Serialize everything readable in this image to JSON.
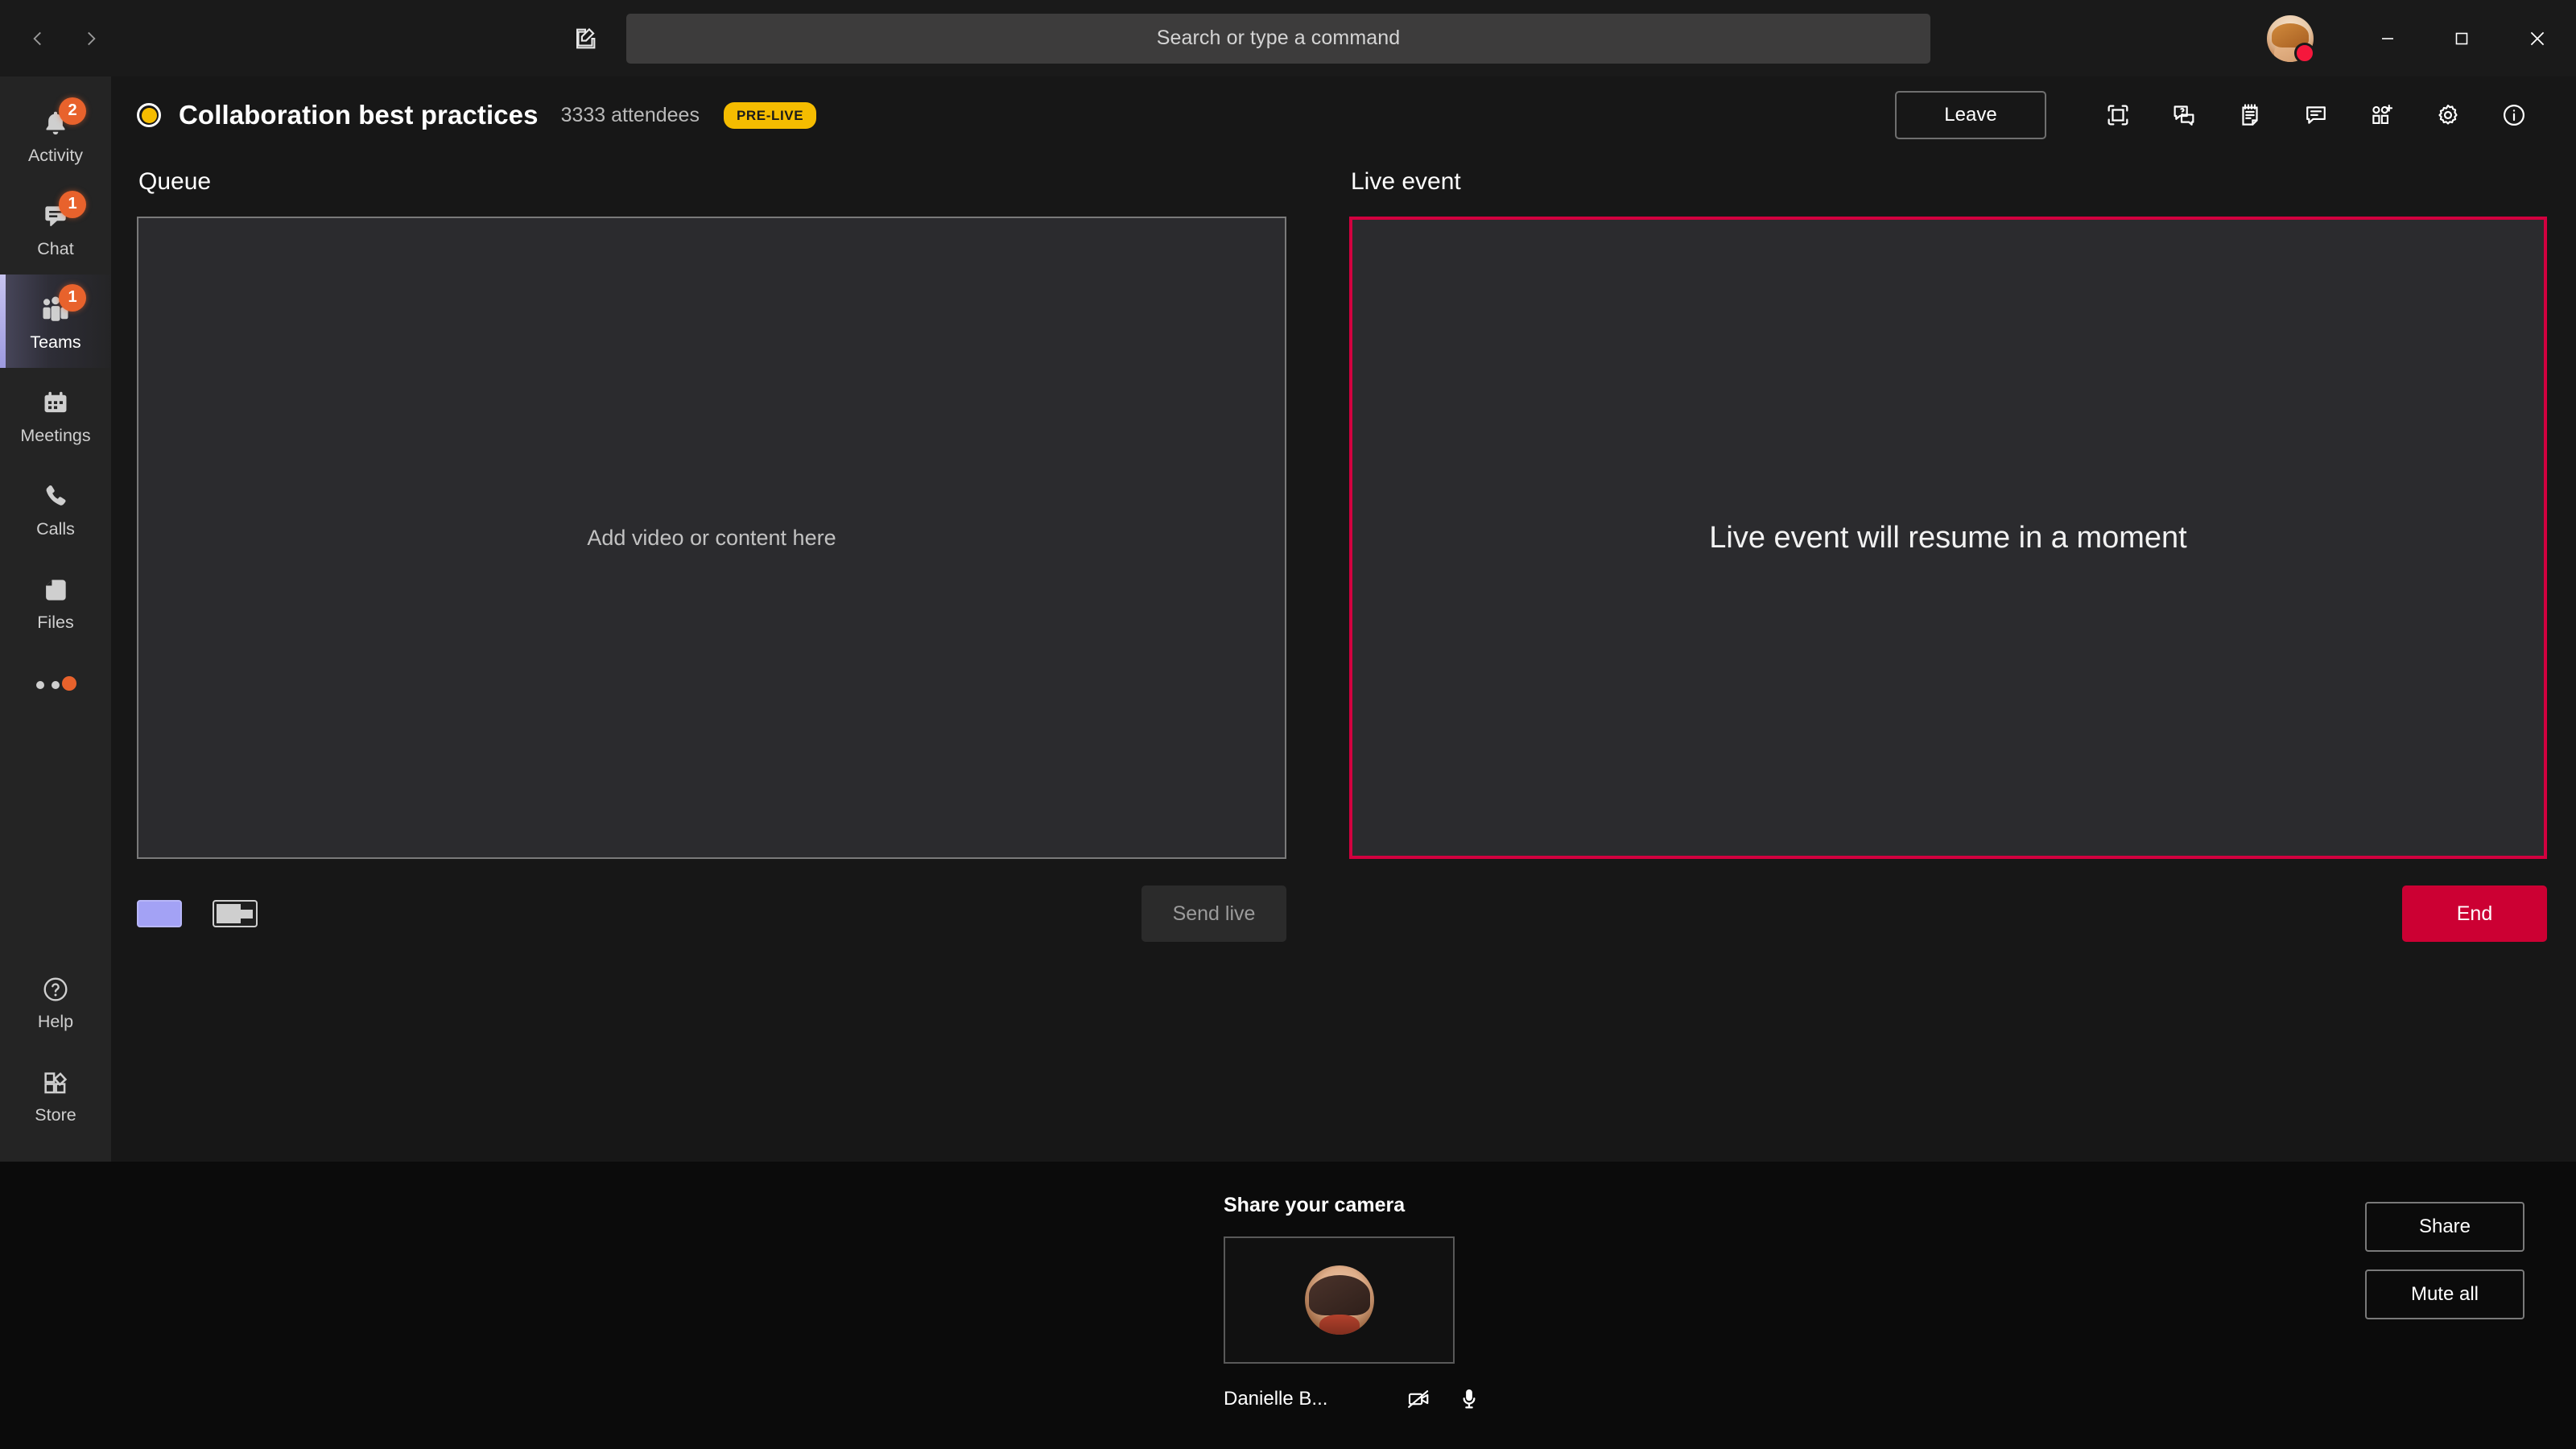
{
  "window": {
    "back_icon": "chevron-left-icon",
    "forward_icon": "chevron-right-icon",
    "compose_icon": "compose-icon",
    "minimize_label": "—",
    "maximize_label": "□",
    "close_label": "✕",
    "presence_color": "#f5173c"
  },
  "search": {
    "placeholder": "Search or type a command"
  },
  "sidebar": {
    "items": [
      {
        "label": "Activity",
        "icon": "bell-icon",
        "badge": "2",
        "active": false
      },
      {
        "label": "Chat",
        "icon": "chat-icon",
        "badge": "1",
        "active": false
      },
      {
        "label": "Teams",
        "icon": "teams-icon",
        "badge": "1",
        "active": true
      },
      {
        "label": "Meetings",
        "icon": "calendar-icon",
        "badge": "",
        "active": false
      },
      {
        "label": "Calls",
        "icon": "phone-icon",
        "badge": "",
        "active": false
      },
      {
        "label": "Files",
        "icon": "files-icon",
        "badge": "",
        "active": false
      }
    ],
    "more": {
      "icon": "ellipsis-icon",
      "has_dot": true
    },
    "bottom": [
      {
        "label": "Help",
        "icon": "help-icon"
      },
      {
        "label": "Store",
        "icon": "store-icon"
      }
    ]
  },
  "event": {
    "title": "Collaboration best practices",
    "attendees": "3333 attendees",
    "status_badge": "PRE-LIVE",
    "status_color": "#f5bc00",
    "leave_label": "Leave",
    "toolbar": [
      {
        "name": "fit-to-frame-icon",
        "title": "Fit to frame"
      },
      {
        "name": "qna-icon",
        "title": "Q&A"
      },
      {
        "name": "meeting-notes-icon",
        "title": "Meeting notes"
      },
      {
        "name": "chat-icon",
        "title": "Chat"
      },
      {
        "name": "add-people-icon",
        "title": "Add people"
      },
      {
        "name": "settings-gear-icon",
        "title": "Settings"
      },
      {
        "name": "info-icon",
        "title": "Info"
      }
    ]
  },
  "queue_panel": {
    "title": "Queue",
    "placeholder": "Add video or content here",
    "layout_solid_color": "#a3a2f5",
    "send_live_label": "Send live"
  },
  "live_panel": {
    "title": "Live event",
    "message": "Live event will resume in a moment",
    "border_color": "#d2003f",
    "end_label": "End",
    "end_color": "#cc0033"
  },
  "bottom": {
    "camera_title": "Share your camera",
    "participant_name": "Danielle B...",
    "camera_icon": "camera-off-icon",
    "mic_icon": "microphone-icon",
    "share_label": "Share",
    "mute_all_label": "Mute all"
  }
}
